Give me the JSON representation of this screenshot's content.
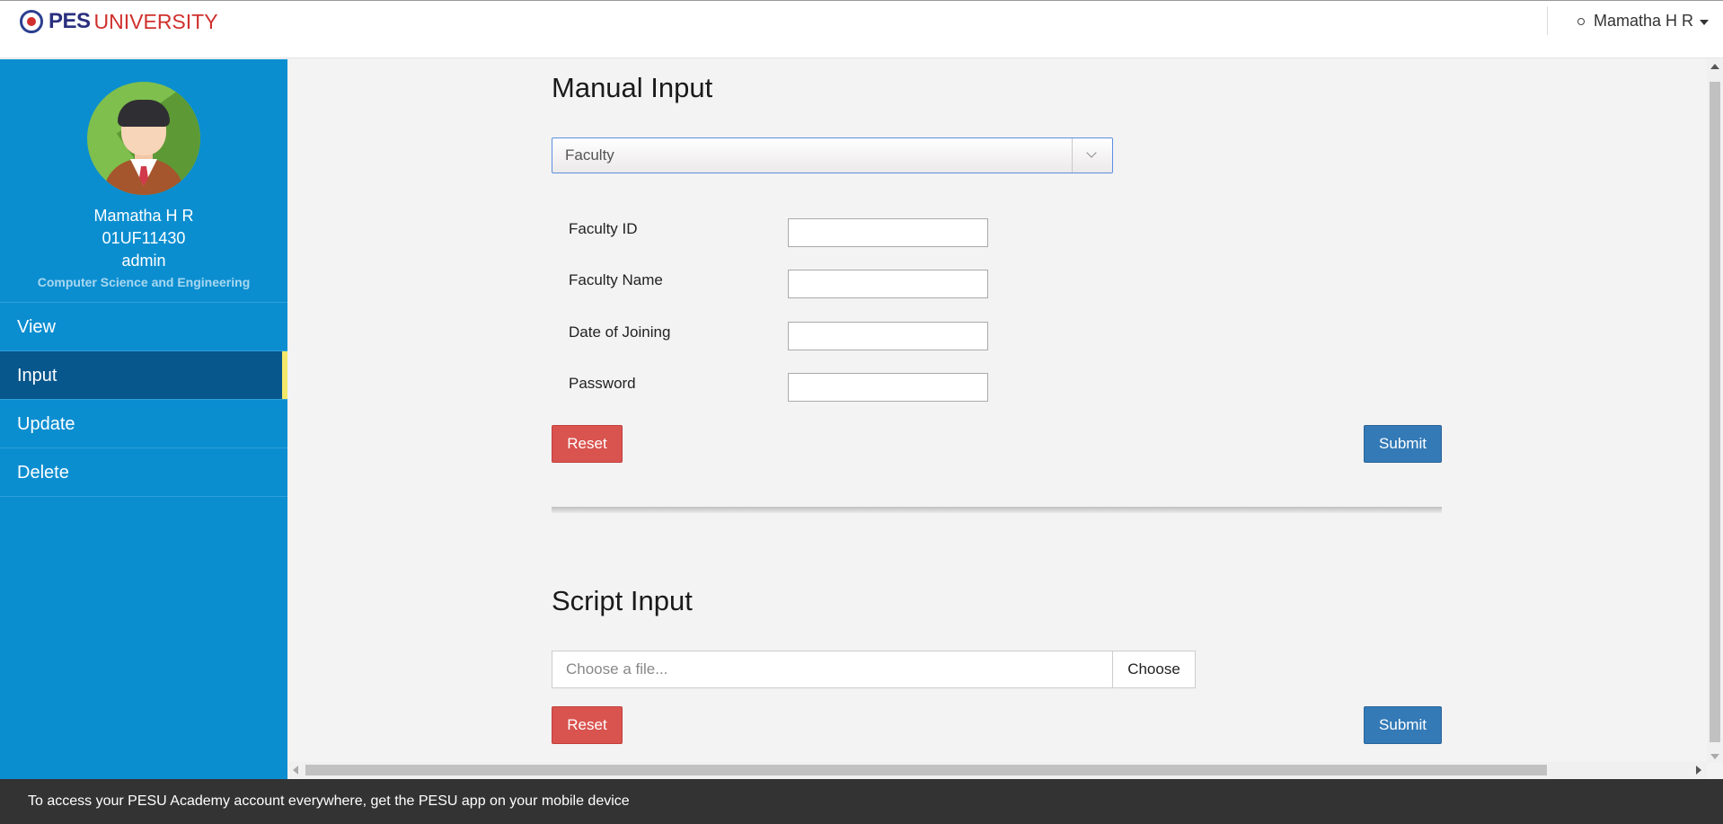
{
  "header": {
    "logo_pes": "PES",
    "logo_university": "UNIVERSITY",
    "user_name": "Mamatha H R"
  },
  "sidebar": {
    "name": "Mamatha H R",
    "id": "01UF11430",
    "role": "admin",
    "department": "Computer Science and Engineering",
    "items": [
      {
        "label": "View"
      },
      {
        "label": "Input",
        "active": true
      },
      {
        "label": "Update"
      },
      {
        "label": "Delete"
      }
    ]
  },
  "manual": {
    "title": "Manual Input",
    "select_value": "Faculty",
    "fields": [
      {
        "label": "Faculty ID",
        "value": ""
      },
      {
        "label": "Faculty Name",
        "value": ""
      },
      {
        "label": "Date of Joining",
        "value": ""
      },
      {
        "label": "Password",
        "value": ""
      }
    ],
    "reset_label": "Reset",
    "submit_label": "Submit"
  },
  "script": {
    "title": "Script Input",
    "file_placeholder": "Choose a file...",
    "choose_label": "Choose",
    "reset_label": "Reset",
    "submit_label": "Submit"
  },
  "banner": {
    "text": "To access your PESU Academy account everywhere, get the PESU app on your mobile device"
  },
  "colors": {
    "sidebar": "#0b8ed0",
    "sidebar_active": "#07568c",
    "reset": "#d9534f",
    "submit": "#337ab7"
  }
}
